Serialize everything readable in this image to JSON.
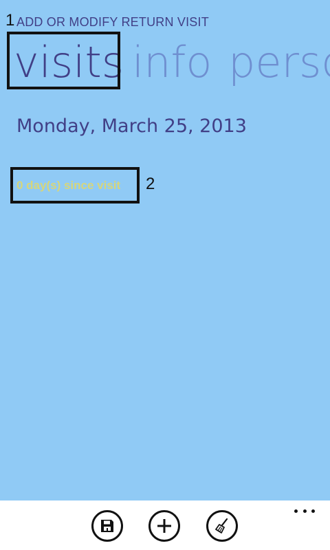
{
  "header": {
    "marker_1": "1",
    "title": "ADD OR MODIFY RETURN VISIT"
  },
  "pivot": {
    "tabs": [
      {
        "label": "visits",
        "active": true
      },
      {
        "label": "info",
        "active": false
      },
      {
        "label": "perso",
        "active": false
      }
    ]
  },
  "content": {
    "date": "Monday, March 25, 2013",
    "since_visit": "0 day(s) since visit",
    "marker_2": "2"
  },
  "appbar": {
    "buttons": [
      {
        "icon": "save-icon"
      },
      {
        "icon": "add-icon"
      },
      {
        "icon": "clear-broom-icon"
      }
    ],
    "more_icon": "ellipsis-icon"
  },
  "colors": {
    "background": "#90caf5",
    "accent": "#413f86",
    "inactive_tab": "#6f8fd0",
    "since_text": "#d7d67b",
    "appbar": "#ffffff"
  }
}
